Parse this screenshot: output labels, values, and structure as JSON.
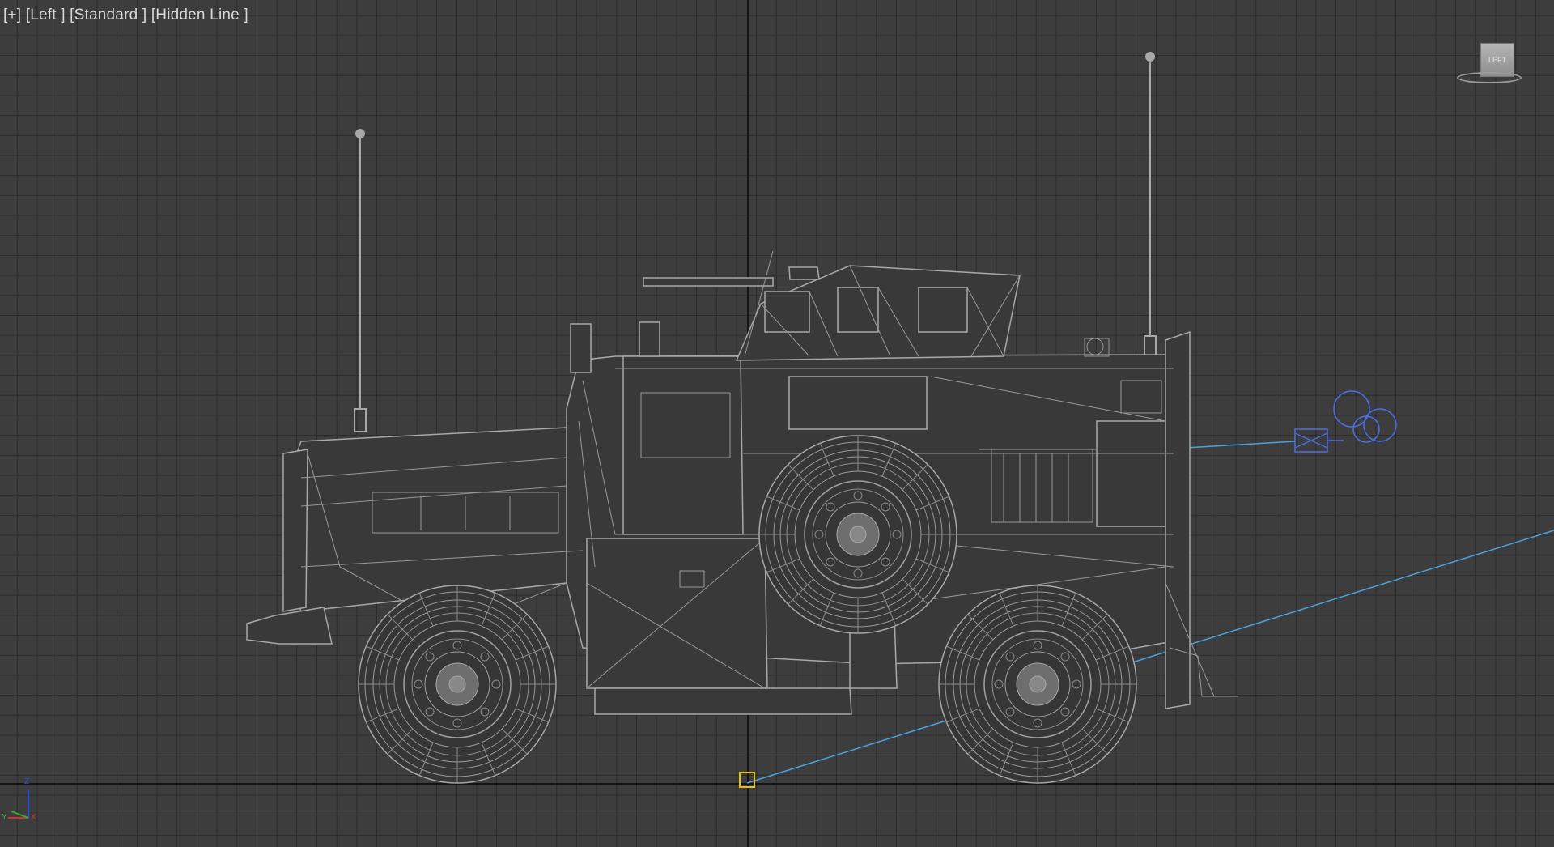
{
  "viewport": {
    "label_plus": "[+]",
    "label_view": "[Left ]",
    "label_camera": "[Standard ]",
    "label_shading": "[Hidden Line ]",
    "viewcube_face": "LEFT",
    "axis_z": "Z",
    "axis_y": "Y",
    "axis_x": "X"
  },
  "colors": {
    "background": "#3d3d3d",
    "grid": "#2b2b2b",
    "wireframe": "#a8a8a8",
    "light_target": "#4aa3df",
    "light_gizmo": "#4b6ee8",
    "pivot": "#e4c21a",
    "world_axis": "#141414"
  },
  "icons": [
    "viewcube-icon",
    "axis-tripod-icon",
    "light-icon",
    "pivot-icon"
  ]
}
